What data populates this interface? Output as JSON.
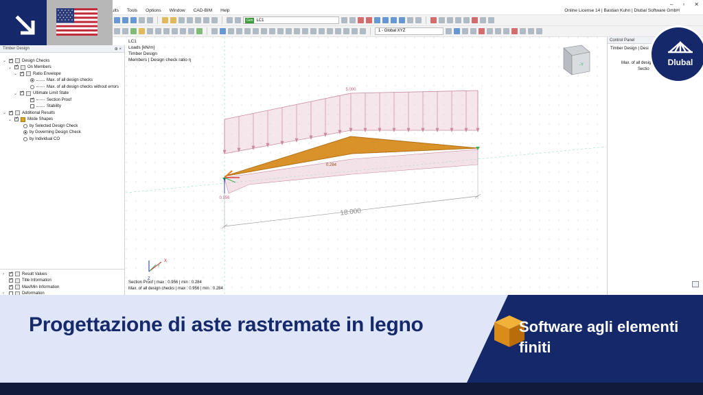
{
  "menu": [
    "esults",
    "Tools",
    "Options",
    "Window",
    "CAD-BIM",
    "Help"
  ],
  "license": "Online License 14 | Bastian Kuhn | Dlubal Software GmbH",
  "window_controls": [
    "–",
    "▫",
    "✕"
  ],
  "toolbar": {
    "load_case_tag": "Gen",
    "load_case": "LC1",
    "view": "1 - Global XYZ"
  },
  "navigator": {
    "title": "Timber Design",
    "pin": "⊕ ×",
    "items": [
      {
        "label": "Design Checks"
      },
      {
        "label": "On Members"
      },
      {
        "label": "Ratio Envelope"
      },
      {
        "label": "Max. of all design checks"
      },
      {
        "label": "Max. of all design checks without errors"
      },
      {
        "label": "Ultimate Limit State"
      },
      {
        "label": "Section Proof"
      },
      {
        "label": "Stability"
      },
      {
        "label": "Additional Results"
      },
      {
        "label": "Mode Shapes"
      },
      {
        "label": "by Selected Design Check"
      },
      {
        "label": "by Governing Design Check"
      },
      {
        "label": "by Individual CO"
      },
      {
        "label": "Result Values"
      },
      {
        "label": "Title Information"
      },
      {
        "label": "Max/Min Information"
      },
      {
        "label": "Deformation"
      }
    ]
  },
  "viewport": {
    "info": [
      "LC1",
      "Loads [kN/m]",
      "Timber Design",
      "Members | Design check ratio η"
    ],
    "load_label": "5.000",
    "ratio_mid": "0.284",
    "ratio_support": "0.956",
    "dimension": "18.000",
    "axes": {
      "x": "X",
      "y": "Y",
      "z": "Z"
    },
    "footer": [
      "Section Proof | max  : 0.956 | min  : 0.284",
      "Max. of all design checks | max  : 0.956 | min  : 0.284"
    ],
    "cube_face": "-Y"
  },
  "control_panel": {
    "title": "Control Panel",
    "line1": "Timber Design | Desi",
    "line2": "Max. of all desig",
    "line3": "Sectio"
  },
  "brand": "Dlubal",
  "banner": {
    "title": "Progettazione di aste rastremate in legno",
    "subtitle": "Software agli elementi finiti"
  },
  "colors": {
    "brand_navy": "#14286a",
    "banner_light": "#dfe6f7",
    "member_orange": "#d9922a",
    "load_pink": "#c98aa0"
  }
}
